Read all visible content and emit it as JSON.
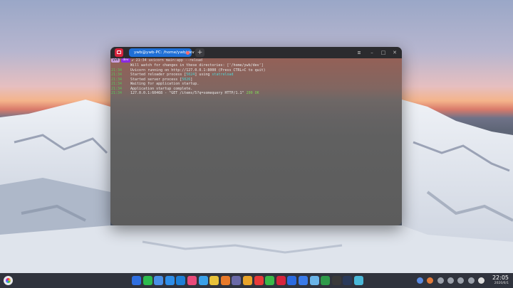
{
  "window": {
    "tab_title": "ywb@ywb-PC: /home/ywb/dev",
    "add_tab_label": "+",
    "menu_icon": "hamburger-icon",
    "minimize_label": "–",
    "maximize_label": "□",
    "close_label": "✕"
  },
  "terminal": {
    "prompt": {
      "user": "ywb",
      "dir": "dev",
      "rest": "✔ 21:34  uvicorn main:app --reload"
    },
    "lines": [
      {
        "time": "",
        "text": "Will watch for changes in these directories: ['/home/ywb/dev']"
      },
      {
        "time": "21:34",
        "text": "Uvicorn running on http://127.0.0.1:8000 (Press CTRL+C to quit)"
      },
      {
        "time": "21:34",
        "text_a": "Started reloader process [",
        "pid": "5024",
        "text_b": "] using ",
        "reloader": "statreload"
      },
      {
        "time": "21:34",
        "text_a": "Started server process [",
        "pid": "5026",
        "text_b": "]"
      },
      {
        "time": "21:34",
        "text": "Waiting for application startup."
      },
      {
        "time": "21:34",
        "text": "Application startup complete."
      },
      {
        "time": "21:34",
        "text_a": "127.0.0.1:60468 - \"GET /items/5?q=somequery HTTP/1.1\" ",
        "status": "200 OK"
      }
    ]
  },
  "taskbar": {
    "time": "22:05",
    "date": "2020/6/1",
    "dock_icons": [
      {
        "name": "wps-writer-icon",
        "color": "#2f6fe0"
      },
      {
        "name": "wechat-icon",
        "color": "#2dbb4e"
      },
      {
        "name": "feather-icon",
        "color": "#4a8fe6"
      },
      {
        "name": "browser-icon",
        "color": "#2f8ee8"
      },
      {
        "name": "vscode-icon",
        "color": "#1e7fd6"
      },
      {
        "name": "jetbrains-icon",
        "color": "#e84a7a"
      },
      {
        "name": "files-icon",
        "color": "#3aa0e8"
      },
      {
        "name": "chrome-icon",
        "color": "#e8c23a"
      },
      {
        "name": "grid-app-icon",
        "color": "#e87a2a"
      },
      {
        "name": "settings-icon",
        "color": "#6a6aa8"
      },
      {
        "name": "checkmark-icon",
        "color": "#e8a42a"
      },
      {
        "name": "netease-music-icon",
        "color": "#e83a3a"
      },
      {
        "name": "pinwheel-icon",
        "color": "#3ab84a"
      },
      {
        "name": "terminal-icon",
        "color": "#d6233d"
      },
      {
        "name": "wps-icon",
        "color": "#2a6ae0"
      },
      {
        "name": "store-icon",
        "color": "#3a7ae8"
      },
      {
        "name": "screenshot-icon",
        "color": "#6ab4e8"
      },
      {
        "name": "torrent-icon",
        "color": "#2e9a4a"
      },
      {
        "name": "media-player-icon",
        "color": "#3a3a3a"
      },
      {
        "name": "typora-icon",
        "color": "#2a3a5a"
      },
      {
        "name": "code-editor-icon",
        "color": "#4ab8d8"
      }
    ],
    "tray_icons": [
      {
        "name": "network-icon",
        "color": "#5a8ae0"
      },
      {
        "name": "app-tray-icon",
        "color": "#e07a3a"
      },
      {
        "name": "volume-icon",
        "color": "#9aa0aa"
      },
      {
        "name": "wifi-icon",
        "color": "#9aa0aa"
      },
      {
        "name": "power-icon",
        "color": "#9aa0aa"
      },
      {
        "name": "chevron-right-icon",
        "color": "#9aa0aa"
      },
      {
        "name": "notification-bell-icon",
        "color": "#dcdcdc"
      }
    ]
  }
}
